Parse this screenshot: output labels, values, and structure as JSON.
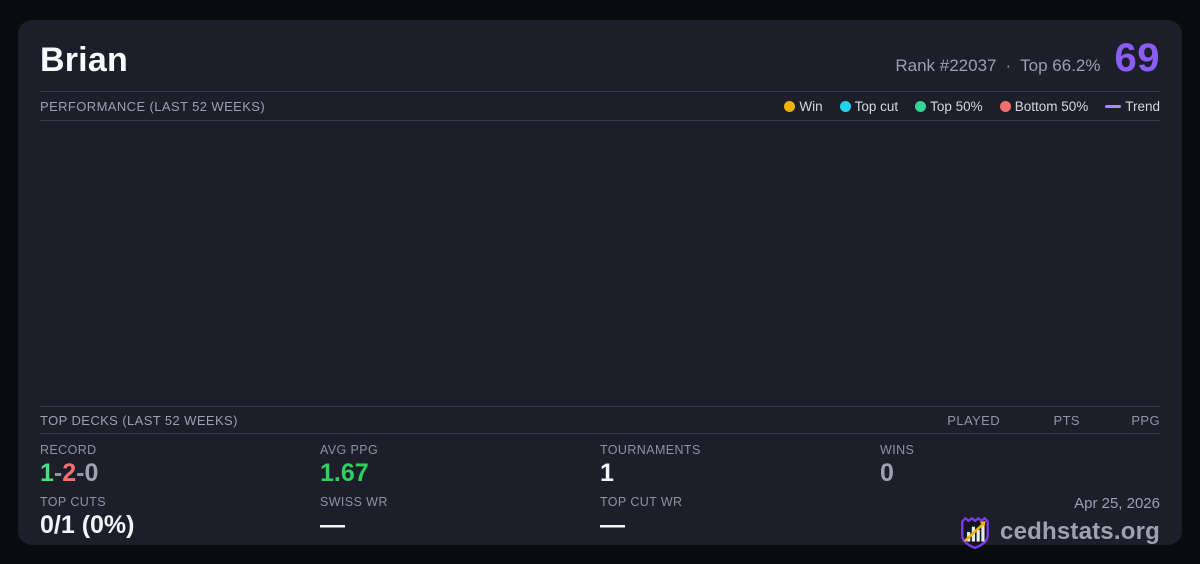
{
  "header": {
    "player_name": "Brian",
    "rank": "Rank #22037",
    "dot_separator": "·",
    "top_percent": "Top 66.2%",
    "score": "69",
    "score_color": "#8b5cf6"
  },
  "performance": {
    "title": "PERFORMANCE (LAST 52 WEEKS)",
    "legend": [
      {
        "label": "Win",
        "color": "#eab308"
      },
      {
        "label": "Top cut",
        "color": "#22d3ee"
      },
      {
        "label": "Top 50%",
        "color": "#34d399"
      },
      {
        "label": "Bottom 50%",
        "color": "#f4706f"
      },
      {
        "label": "Trend",
        "color": "#a78bfa"
      }
    ],
    "chart": {
      "type": "scatter",
      "points": []
    }
  },
  "top_decks": {
    "title": "TOP DECKS (LAST 52 WEEKS)",
    "columns": {
      "0": "PLAYED",
      "1": "PTS",
      "2": "PPG"
    },
    "rows": []
  },
  "stats": {
    "record": {
      "label": "RECORD",
      "wins": "1",
      "losses": "2",
      "draws": "0",
      "separator": "-",
      "wins_color": "#4ade80",
      "losses_color": "#f4706f",
      "draws_color": "#9ca3af"
    },
    "avg_ppg": {
      "label": "AVG PPG",
      "value": "1.67",
      "color": "#2fd05c"
    },
    "tournaments": {
      "label": "TOURNAMENTS",
      "value": "1"
    },
    "wins": {
      "label": "WINS",
      "value": "0",
      "color": "#9ca3af"
    },
    "top_cuts": {
      "label": "TOP CUTS",
      "value": "0/1 (0%)"
    },
    "swiss_wr": {
      "label": "SWISS WR",
      "value": "—"
    },
    "top_cut_wr": {
      "label": "TOP CUT WR",
      "value": "—"
    }
  },
  "footer": {
    "date": "Apr 25, 2026",
    "site_name": "cedhstats.org"
  }
}
